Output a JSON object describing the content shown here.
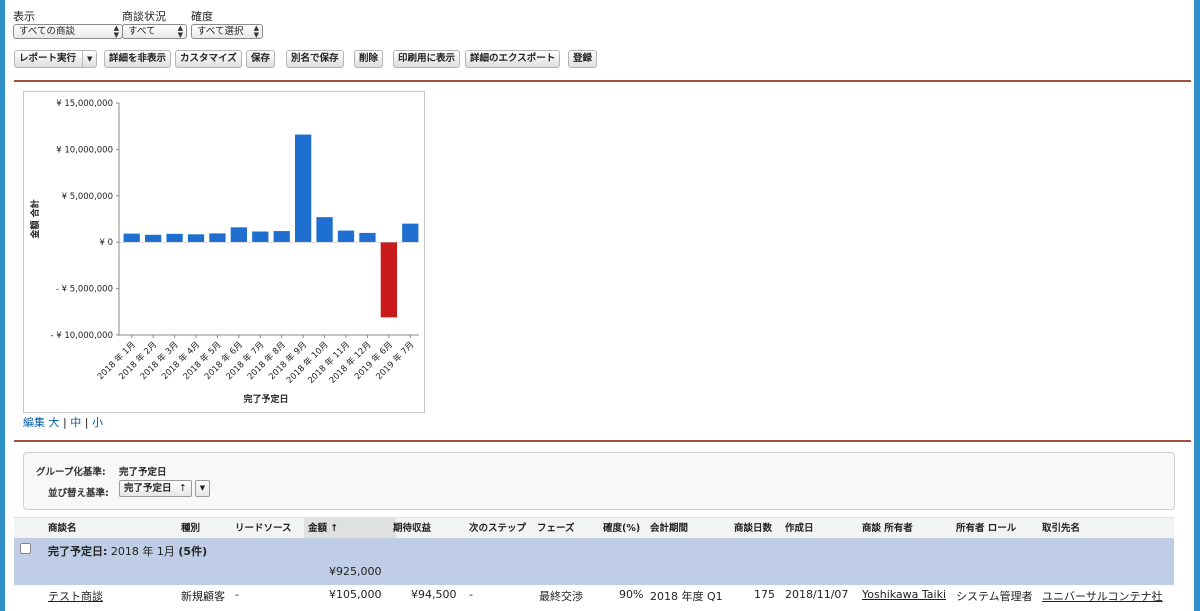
{
  "filters": [
    {
      "label": "表示",
      "value": "すべての商談"
    },
    {
      "label": "商談状況",
      "value": "すべて"
    },
    {
      "label": "確度",
      "value": "すべて選択"
    }
  ],
  "toolbar": {
    "run_report": "レポート実行",
    "hide_details": "詳細を非表示",
    "customize": "カスタマイズ",
    "save": "保存",
    "save_as": "別名で保存",
    "delete": "削除",
    "printable_view": "印刷用に表示",
    "export_details": "詳細のエクスポート",
    "register": "登録"
  },
  "chart_links": {
    "edit": "編集",
    "large": "大",
    "medium": "中",
    "small": "小",
    "sep": "|"
  },
  "chart_data": {
    "type": "bar",
    "title": "",
    "xlabel": "完了予定日",
    "ylabel": "金額 合計",
    "categories": [
      "2018 年 1月",
      "2018 年 2月",
      "2018 年 3月",
      "2018 年 4月",
      "2018 年 5月",
      "2018 年 6月",
      "2018 年 7月",
      "2018 年 8月",
      "2018 年 9月",
      "2018 年 10月",
      "2018 年 11月",
      "2018 年 12月",
      "2019 年 6月",
      "2019 年 7月"
    ],
    "values": [
      925000,
      800000,
      900000,
      850000,
      950000,
      1600000,
      1150000,
      1200000,
      11600000,
      2700000,
      1250000,
      1000000,
      -8100000,
      2000000
    ],
    "ylim": [
      -10000000,
      15000000
    ],
    "ytick_values": [
      15000000,
      10000000,
      5000000,
      0,
      -5000000,
      -10000000
    ],
    "ytick_labels": [
      "¥ 15,000,000",
      "¥ 10,000,000",
      "¥ 5,000,000",
      "¥ 0",
      "- ¥ 5,000,000",
      "- ¥ 10,000,000"
    ],
    "colors": {
      "positive": "#1f6fd0",
      "negative": "#c9191a"
    },
    "grid": false
  },
  "grouping": {
    "group_label": "グループ化基準:",
    "group_value": "完了予定日",
    "sort_label": "並び替え基準:",
    "sort_value": "完了予定日",
    "sort_arrow": "↑"
  },
  "table": {
    "columns": [
      "商談名",
      "種別",
      "リードソース",
      "金額 ↑",
      "期待収益",
      "次のステップ",
      "フェーズ",
      "確度(%)",
      "会計期間",
      "商談日数",
      "作成日",
      "商談 所有者",
      "所有者 ロール",
      "取引先名"
    ],
    "group": {
      "label": "完了予定日:",
      "value": "2018 年 1月",
      "count": "(5件)",
      "total": "¥925,000"
    },
    "rows": [
      {
        "name": "テスト商談",
        "type": "新規顧客",
        "lead_source": "-",
        "amount": "¥105,000",
        "expected_revenue": "¥94,500",
        "next_step": "-",
        "stage": "最終交渉",
        "probability": "90%",
        "fiscal_period": "2018 年度 Q1",
        "age": "175",
        "created": "2018/11/07",
        "owner": "Yoshikawa Taiki",
        "owner_role": "システム管理者",
        "account": "ユニバーサルコンテナ社"
      }
    ]
  }
}
